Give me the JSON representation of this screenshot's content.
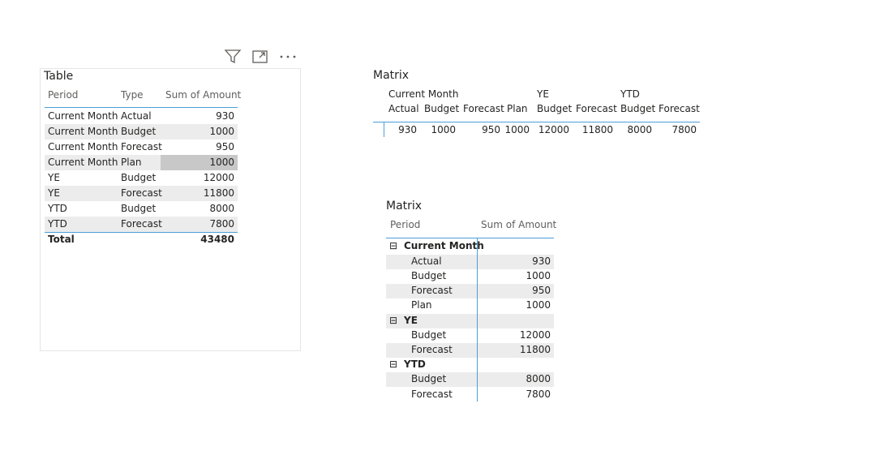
{
  "colors": {
    "accent_line": "#4a9fd9",
    "alt_row": "#ececec",
    "selected_cell": "#c8c8c8"
  },
  "toolbar": {
    "filter_icon": "filter-icon",
    "focus_icon": "focus-mode-icon",
    "more_icon": "more-options-icon"
  },
  "table": {
    "title": "Table",
    "headers": [
      "Period",
      "Type",
      "Sum of Amount"
    ],
    "rows": [
      [
        "Current Month",
        "Actual",
        "930"
      ],
      [
        "Current Month",
        "Budget",
        "1000"
      ],
      [
        "Current Month",
        "Forecast",
        "950"
      ],
      [
        "Current Month",
        "Plan",
        "1000"
      ],
      [
        "YE",
        "Budget",
        "12000"
      ],
      [
        "YE",
        "Forecast",
        "11800"
      ],
      [
        "YTD",
        "Budget",
        "8000"
      ],
      [
        "YTD",
        "Forecast",
        "7800"
      ]
    ],
    "total_label": "Total",
    "total_value": "43480"
  },
  "matrix1": {
    "title": "Matrix",
    "groups": [
      "Current Month",
      "YE",
      "YTD"
    ],
    "subheaders": [
      "Actual",
      "Budget",
      "Forecast",
      "Plan",
      "Budget",
      "Forecast",
      "Budget",
      "Forecast"
    ],
    "values": [
      "930",
      "1000",
      "950",
      "1000",
      "12000",
      "11800",
      "8000",
      "7800"
    ]
  },
  "matrix2": {
    "title": "Matrix",
    "headers": [
      "Period",
      "Sum of Amount"
    ],
    "groups": [
      {
        "label": "Current Month",
        "expand_icon": "collapse-icon",
        "rows": [
          [
            "Actual",
            "930"
          ],
          [
            "Budget",
            "1000"
          ],
          [
            "Forecast",
            "950"
          ],
          [
            "Plan",
            "1000"
          ]
        ]
      },
      {
        "label": "YE",
        "expand_icon": "collapse-icon",
        "rows": [
          [
            "Budget",
            "12000"
          ],
          [
            "Forecast",
            "11800"
          ]
        ]
      },
      {
        "label": "YTD",
        "expand_icon": "collapse-icon",
        "rows": [
          [
            "Budget",
            "8000"
          ],
          [
            "Forecast",
            "7800"
          ]
        ]
      }
    ]
  }
}
